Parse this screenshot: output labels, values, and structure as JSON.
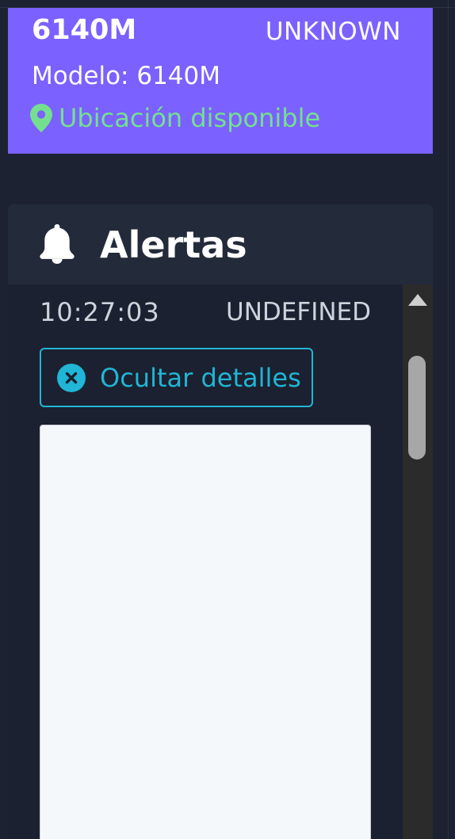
{
  "vehicle": {
    "name": "6140M",
    "status": "UNKNOWN",
    "model_text": "Modelo: 6140M",
    "location_text": "Ubicación disponible",
    "location_icon": "map-pin-icon",
    "card_color": "#7b61ff",
    "location_color": "#74e08f"
  },
  "alerts": {
    "title": "Alertas",
    "icon": "bell-icon",
    "items": [
      {
        "time": "10:27:03",
        "type": "UNDEFINED",
        "toggle_label": "Ocultar detalles",
        "toggle_icon": "close-circle-icon"
      }
    ],
    "accent_color": "#21b5d6"
  }
}
